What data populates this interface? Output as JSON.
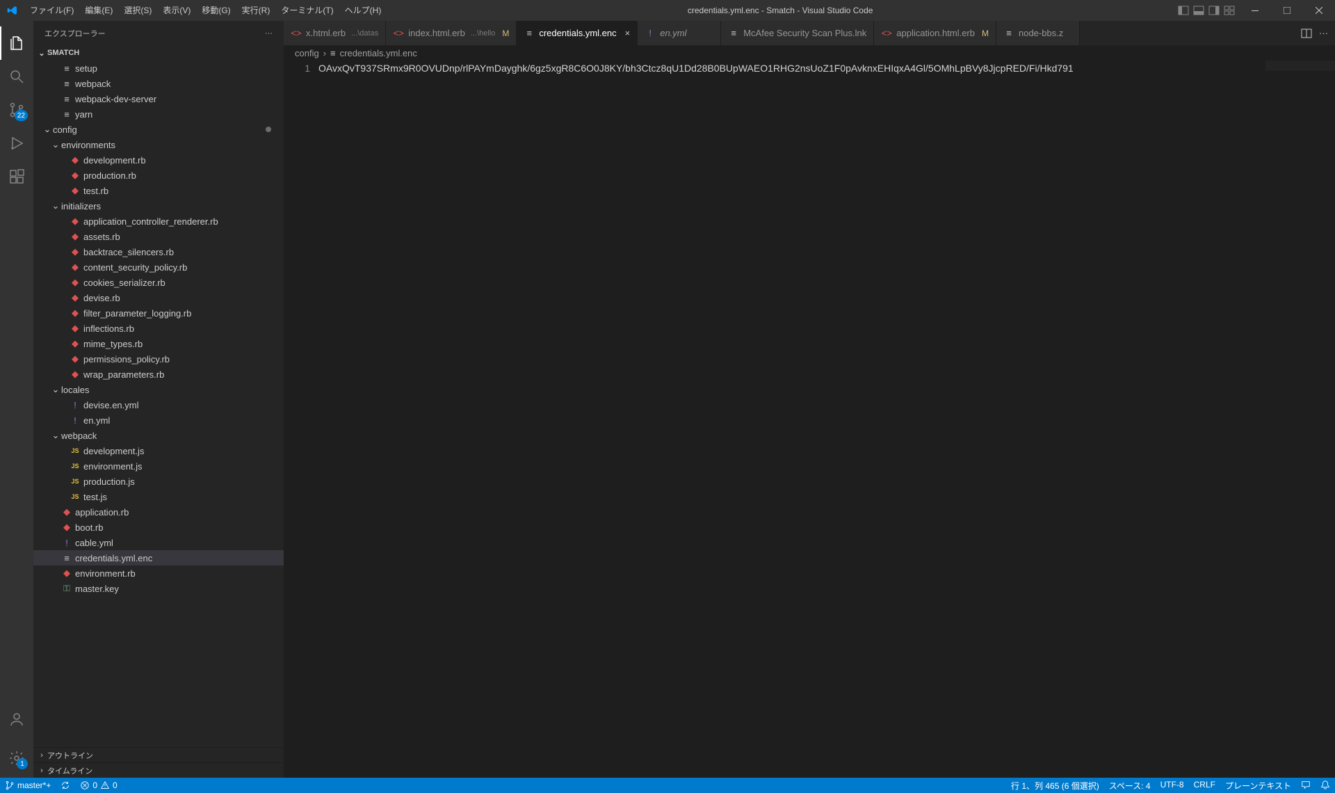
{
  "menu": {
    "file": "ファイル(F)",
    "edit": "編集(E)",
    "selection": "選択(S)",
    "view": "表示(V)",
    "go": "移動(G)",
    "run": "実行(R)",
    "terminal": "ターミナル(T)",
    "help": "ヘルプ(H)"
  },
  "title": "credentials.yml.enc - Smatch - Visual Studio Code",
  "activity": {
    "scm_badge": "22",
    "settings_badge": "1"
  },
  "sidebar": {
    "title": "エクスプローラー",
    "project": "SMATCH",
    "outline": "アウトライン",
    "timeline": "タイムライン"
  },
  "tree": [
    {
      "indent": 1,
      "type": "file",
      "icon": "generic",
      "name": "setup"
    },
    {
      "indent": 1,
      "type": "file",
      "icon": "generic",
      "name": "webpack"
    },
    {
      "indent": 1,
      "type": "file",
      "icon": "generic",
      "name": "webpack-dev-server"
    },
    {
      "indent": 1,
      "type": "file",
      "icon": "generic",
      "name": "yarn"
    },
    {
      "indent": 0,
      "type": "folder",
      "open": true,
      "name": "config",
      "dot": true
    },
    {
      "indent": 1,
      "type": "folder",
      "open": true,
      "name": "environments"
    },
    {
      "indent": 2,
      "type": "file",
      "icon": "ruby",
      "name": "development.rb"
    },
    {
      "indent": 2,
      "type": "file",
      "icon": "ruby",
      "name": "production.rb"
    },
    {
      "indent": 2,
      "type": "file",
      "icon": "ruby",
      "name": "test.rb"
    },
    {
      "indent": 1,
      "type": "folder",
      "open": true,
      "name": "initializers"
    },
    {
      "indent": 2,
      "type": "file",
      "icon": "ruby",
      "name": "application_controller_renderer.rb"
    },
    {
      "indent": 2,
      "type": "file",
      "icon": "ruby",
      "name": "assets.rb"
    },
    {
      "indent": 2,
      "type": "file",
      "icon": "ruby",
      "name": "backtrace_silencers.rb"
    },
    {
      "indent": 2,
      "type": "file",
      "icon": "ruby",
      "name": "content_security_policy.rb"
    },
    {
      "indent": 2,
      "type": "file",
      "icon": "ruby",
      "name": "cookies_serializer.rb"
    },
    {
      "indent": 2,
      "type": "file",
      "icon": "ruby",
      "name": "devise.rb"
    },
    {
      "indent": 2,
      "type": "file",
      "icon": "ruby",
      "name": "filter_parameter_logging.rb"
    },
    {
      "indent": 2,
      "type": "file",
      "icon": "ruby",
      "name": "inflections.rb"
    },
    {
      "indent": 2,
      "type": "file",
      "icon": "ruby",
      "name": "mime_types.rb"
    },
    {
      "indent": 2,
      "type": "file",
      "icon": "ruby",
      "name": "permissions_policy.rb"
    },
    {
      "indent": 2,
      "type": "file",
      "icon": "ruby",
      "name": "wrap_parameters.rb"
    },
    {
      "indent": 1,
      "type": "folder",
      "open": true,
      "name": "locales"
    },
    {
      "indent": 2,
      "type": "file",
      "icon": "yml",
      "name": "devise.en.yml"
    },
    {
      "indent": 2,
      "type": "file",
      "icon": "yml",
      "name": "en.yml"
    },
    {
      "indent": 1,
      "type": "folder",
      "open": true,
      "name": "webpack"
    },
    {
      "indent": 2,
      "type": "file",
      "icon": "js",
      "name": "development.js"
    },
    {
      "indent": 2,
      "type": "file",
      "icon": "js",
      "name": "environment.js"
    },
    {
      "indent": 2,
      "type": "file",
      "icon": "js",
      "name": "production.js"
    },
    {
      "indent": 2,
      "type": "file",
      "icon": "js",
      "name": "test.js"
    },
    {
      "indent": 1,
      "type": "file",
      "icon": "ruby",
      "name": "application.rb"
    },
    {
      "indent": 1,
      "type": "file",
      "icon": "ruby",
      "name": "boot.rb"
    },
    {
      "indent": 1,
      "type": "file",
      "icon": "yml",
      "name": "cable.yml"
    },
    {
      "indent": 1,
      "type": "file",
      "icon": "generic",
      "name": "credentials.yml.enc",
      "selected": true
    },
    {
      "indent": 1,
      "type": "file",
      "icon": "ruby",
      "name": "environment.rb"
    },
    {
      "indent": 1,
      "type": "file",
      "icon": "key",
      "name": "master.key"
    }
  ],
  "tabs": [
    {
      "icon": "erb",
      "label": "x.html.erb",
      "desc": "...\\datas"
    },
    {
      "icon": "erb",
      "label": "index.html.erb",
      "desc": "...\\hello",
      "mod": "M"
    },
    {
      "icon": "generic",
      "label": "credentials.yml.enc",
      "active": true,
      "close": true
    },
    {
      "icon": "yml",
      "label": "en.yml",
      "italic": true
    },
    {
      "icon": "generic",
      "label": "McAfee Security Scan Plus.lnk"
    },
    {
      "icon": "erb",
      "label": "application.html.erb",
      "mod": "M"
    },
    {
      "icon": "generic",
      "label": "node-bbs.z"
    }
  ],
  "breadcrumb": {
    "seg1": "config",
    "seg2": "credentials.yml.enc"
  },
  "editor": {
    "line_number": "1",
    "content": "OAvxQvT937SRmx9R0OVUDnp/rlPAYmDayghk/6gz5xgR8C6O0J8KY/bh3Ctcz8qU1Dd28B0BUpWAEO1RHG2nsUoZ1F0pAvknxEHIqxA4Gl/5OMhLpBVy8JjcpRED/Fi/Hkd791"
  },
  "status": {
    "branch": "master*+",
    "sync": "",
    "errors": "0",
    "warnings": "0",
    "cursor": "行 1、列 465 (6 個選択)",
    "spaces": "スペース: 4",
    "encoding": "UTF-8",
    "eol": "CRLF",
    "lang": "プレーンテキスト",
    "feedback": "",
    "bell": ""
  }
}
